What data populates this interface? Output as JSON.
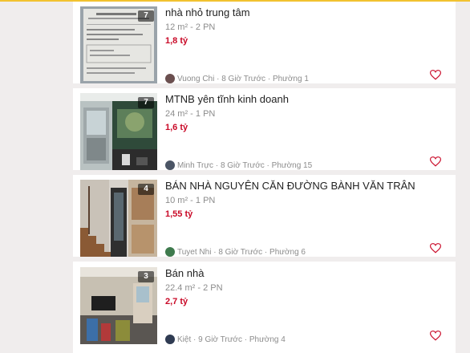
{
  "listings": [
    {
      "title": "nhà nhỏ trung tâm",
      "meta": "12 m² - 2 PN",
      "price": "1,8 tỷ",
      "photo_count": "7",
      "seller": "Vuong Chi",
      "posted": "8 Giờ Trước",
      "area": "Phường 1",
      "photo_icon": "document-photo",
      "avatar_color": "#6b4f4f"
    },
    {
      "title": "MTNB yên tĩnh kinh doanh",
      "meta": "24 m² - 1 PN",
      "price": "1,6 tỷ",
      "photo_count": "7",
      "seller": "Minh Trực",
      "posted": "8 Giờ Trước",
      "area": "Phường 15",
      "photo_icon": "shopfront-photo",
      "avatar_color": "#4b5565"
    },
    {
      "title": "BÁN NHÀ NGUYÊN CĂN ĐƯỜNG BÀNH VĂN TRÂN",
      "meta": "10 m² - 1 PN",
      "price": "1,55 tỷ",
      "photo_count": "4",
      "seller": "Tuyet Nhi",
      "posted": "8 Giờ Trước",
      "area": "Phường 6",
      "photo_icon": "staircase-photo",
      "avatar_color": "#3e7a4d"
    },
    {
      "title": "Bán nhà",
      "meta": "22.4 m² - 2 PN",
      "price": "2,7 tỷ",
      "photo_count": "3",
      "seller": "Kiệt",
      "posted": "9 Giờ Trước",
      "area": "Phường 4",
      "photo_icon": "interior-photo",
      "avatar_color": "#2f3b52"
    }
  ],
  "separator": " · ",
  "colors": {
    "accent_bar": "#f2c230",
    "price": "#c90927",
    "heart": "#c90927"
  }
}
